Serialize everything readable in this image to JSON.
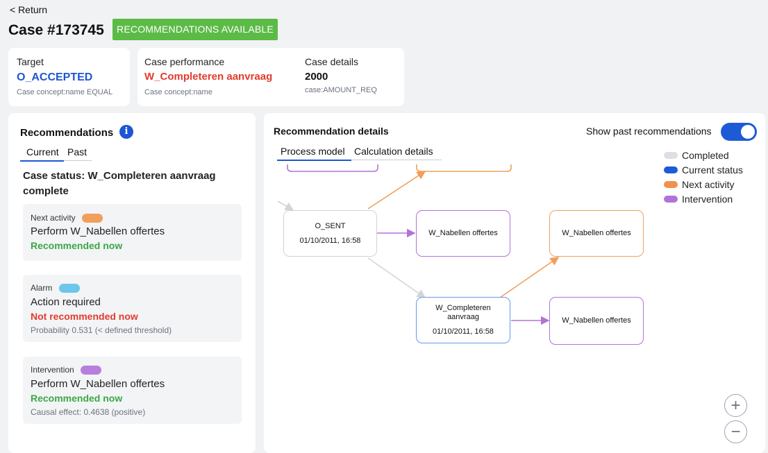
{
  "header": {
    "return_label": "< Return",
    "case_title": "Case #173745",
    "badge": "RECOMMENDATIONS AVAILABLE"
  },
  "target": {
    "label": "Target",
    "value": "O_ACCEPTED",
    "sub": "Case concept:name EQUAL"
  },
  "performance": {
    "label": "Case performance",
    "value": "W_Completeren aanvraag",
    "sub": "Case concept:name"
  },
  "details": {
    "label": "Case details",
    "value": "2000",
    "sub": "case:AMOUNT_REQ"
  },
  "recommendations": {
    "title": "Recommendations",
    "info_icon": "info-icon",
    "tabs": [
      "Current",
      "Past"
    ],
    "status": "Case status: W_Completeren aanvraag complete",
    "items": [
      {
        "kind": "Next activity",
        "color": "#f0a05c",
        "action": "Perform W_Nabellen offertes",
        "verdict": "Recommended now",
        "note": ""
      },
      {
        "kind": "Alarm",
        "color": "#6cc7ea",
        "action": "Action required",
        "verdict": "Not recommended now",
        "note": "Probability 0.531 (< defined threshold)"
      },
      {
        "kind": "Intervention",
        "color": "#b77fdc",
        "action": "Perform W_Nabellen offertes",
        "verdict": "Recommended now",
        "note": "Causal effect: 0.4638 (positive)"
      }
    ]
  },
  "rec_details": {
    "title": "Recommendation details",
    "toggle_label": "Show past recommendations",
    "toggle_on": true,
    "tabs": [
      "Process model",
      "Calculation details"
    ],
    "legend": [
      {
        "label": "Completed",
        "color": "#dcdfe4"
      },
      {
        "label": "Current status",
        "color": "#1d5bd6"
      },
      {
        "label": "Next activity",
        "color": "#f0924c"
      },
      {
        "label": "Intervention",
        "color": "#b273d9"
      }
    ]
  },
  "process_model": {
    "nodes": [
      {
        "id": "o_sent",
        "title": "O_SENT",
        "time": "01/10/2011, 16:58",
        "status": "completed"
      },
      {
        "id": "w_nab_1",
        "title": "W_Nabellen offertes",
        "time": "",
        "status": "intervention"
      },
      {
        "id": "w_nab_2",
        "title": "W_Nabellen offertes",
        "time": "",
        "status": "next"
      },
      {
        "id": "w_comp",
        "title": "W_Completeren aanvraag",
        "time": "01/10/2011, 16:58",
        "status": "current"
      },
      {
        "id": "w_nab_3",
        "title": "W_Nabellen offertes",
        "time": "",
        "status": "intervention"
      }
    ]
  },
  "zoom": {
    "in": "+",
    "out": "−"
  }
}
